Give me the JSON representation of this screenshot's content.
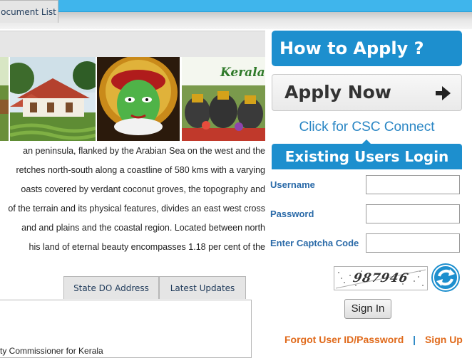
{
  "article": {
    "lines": [
      "an peninsula, flanked by the Arabian Sea on the west and the",
      "retches north-south along a coastline of 580 kms with a varying",
      "oasts covered by verdant coconut groves, the topography and",
      "of the terrain and its physical features, divides an east west cross",
      "and and plains and the coastal region. Located between north",
      "his land of eternal beauty encompasses 1.18 per cent of the"
    ]
  },
  "banner": {
    "kerala_label": "Kerala"
  },
  "tabs": [
    {
      "label": "ocument List"
    },
    {
      "label": "State DO Address"
    },
    {
      "label": "Latest Updates"
    }
  ],
  "tab_content": {
    "item": "ty Commissioner for Kerala"
  },
  "sidebar": {
    "how_to_apply": "How to Apply ?",
    "apply_now": "Apply Now",
    "csc_link": "Click for CSC Connect",
    "login_title": "Existing Users Login",
    "username_label": "Username",
    "password_label": "Password",
    "captcha_label": "Enter Captcha Code",
    "captcha_text": "987946",
    "signin_label": "Sign In",
    "forgot_link": "Forgot User ID/Password",
    "separator": "|",
    "signup_link": "Sign Up"
  },
  "colors": {
    "accent_blue": "#1d8fce",
    "topbar_blue": "#3fb5ec",
    "link_orange": "#e06a1b",
    "label_blue": "#2a6aa8"
  },
  "icons": {
    "apply_arrow": "arrow-right-icon",
    "captcha_refresh": "refresh-icon"
  }
}
